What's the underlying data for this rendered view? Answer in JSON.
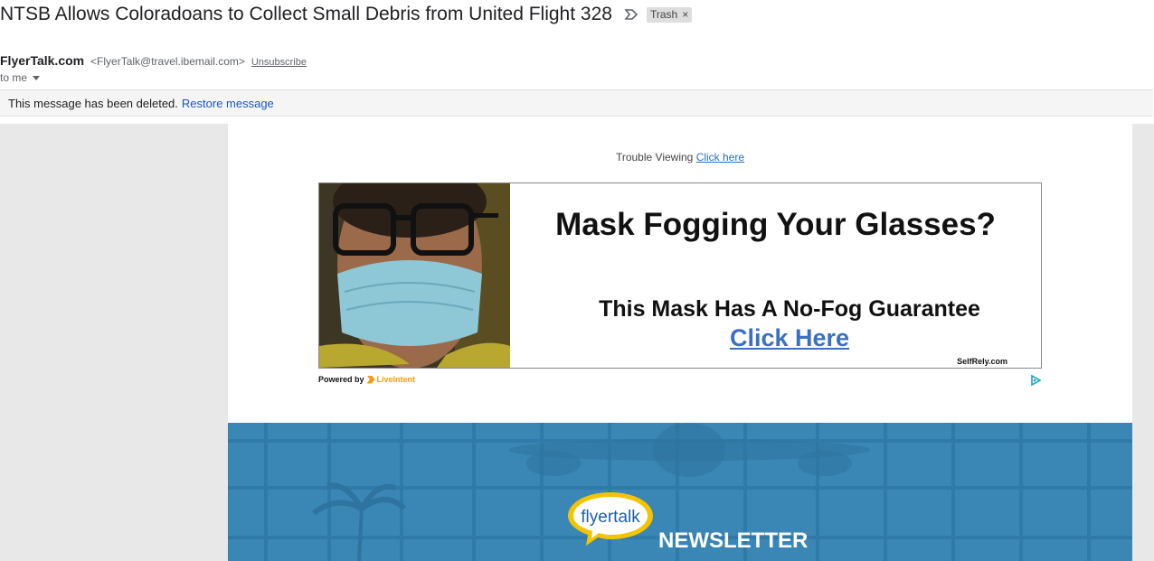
{
  "email": {
    "subject": "NTSB Allows Coloradoans to Collect Small Debris from United Flight 328",
    "label": "Trash",
    "label_remove": "×",
    "sender_name": "FlyerTalk.com",
    "sender_email": "<FlyerTalk@travel.ibemail.com>",
    "unsubscribe": "Unsubscribe",
    "to": "to me"
  },
  "deleted_notice": {
    "text": "This message has been deleted.",
    "restore_link": "Restore message"
  },
  "content": {
    "trouble_text": "Trouble Viewing",
    "trouble_link": "Click here",
    "ad": {
      "headline": "Mask Fogging Your Glasses?",
      "subline": "This Mask Has A No-Fog Guarantee",
      "cta": "Click Here",
      "brand": "SelfRely.com"
    },
    "powered_by": "Powered by",
    "liveintent": "LiveIntent",
    "banner": {
      "logo_text": "flyertalk",
      "title": "NEWSLETTER"
    }
  },
  "colors": {
    "link": "#1a56c4",
    "banner": "#3a86b4",
    "logo_yellow": "#f5c400",
    "liveintent_orange": "#f39c12"
  },
  "icons": {
    "importance": "importance-marker-icon",
    "caret": "caret-down-icon",
    "adchoices": "adchoices-icon"
  }
}
